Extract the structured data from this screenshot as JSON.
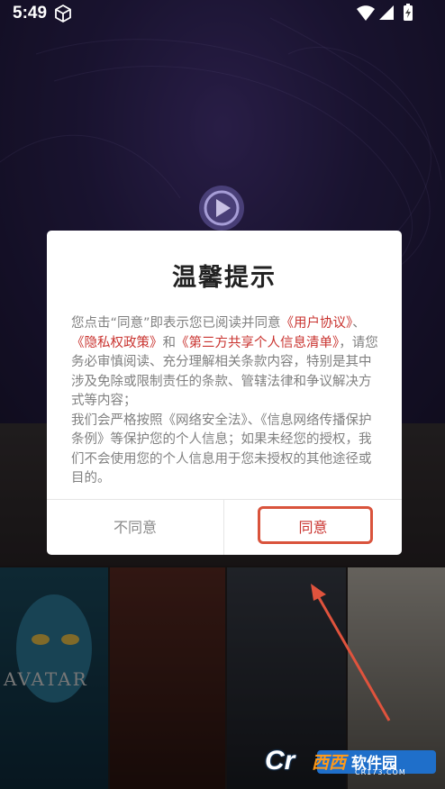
{
  "status_bar": {
    "time": "5:49"
  },
  "dialog": {
    "title": "温馨提示",
    "body": {
      "t1": "您点击“同意”即表示您已阅读并同意",
      "l1": "《用户协议》",
      "t2": "、",
      "l2": "《隐私权政策》",
      "t3": "和",
      "l3": "《第三方共享个人信息清单》",
      "t4": "，请您务必审慎阅读、充分理解相关条款内容，特别是其中涉及免除或限制责任的条款、管辖法律和争议解决方式等内容；",
      "t5": "我们会严格按照《网络安全法》、《信息网络传播保护条例》等保护您的个人信息；如果未经您的授权，我们不会使用您的个人信息用于您未授权的其他途径或目的。"
    },
    "disagree_label": "不同意",
    "agree_label": "同意"
  },
  "background": {
    "poster_avatar_text": "AVATAR"
  },
  "watermark": {
    "brand": "Cr",
    "xixi": "西西",
    "site": "软件园",
    "url": "CR173.COM"
  },
  "colors": {
    "accent_red": "#c9332f",
    "highlight_box": "#d9533c",
    "arrow": "#e0533d"
  }
}
